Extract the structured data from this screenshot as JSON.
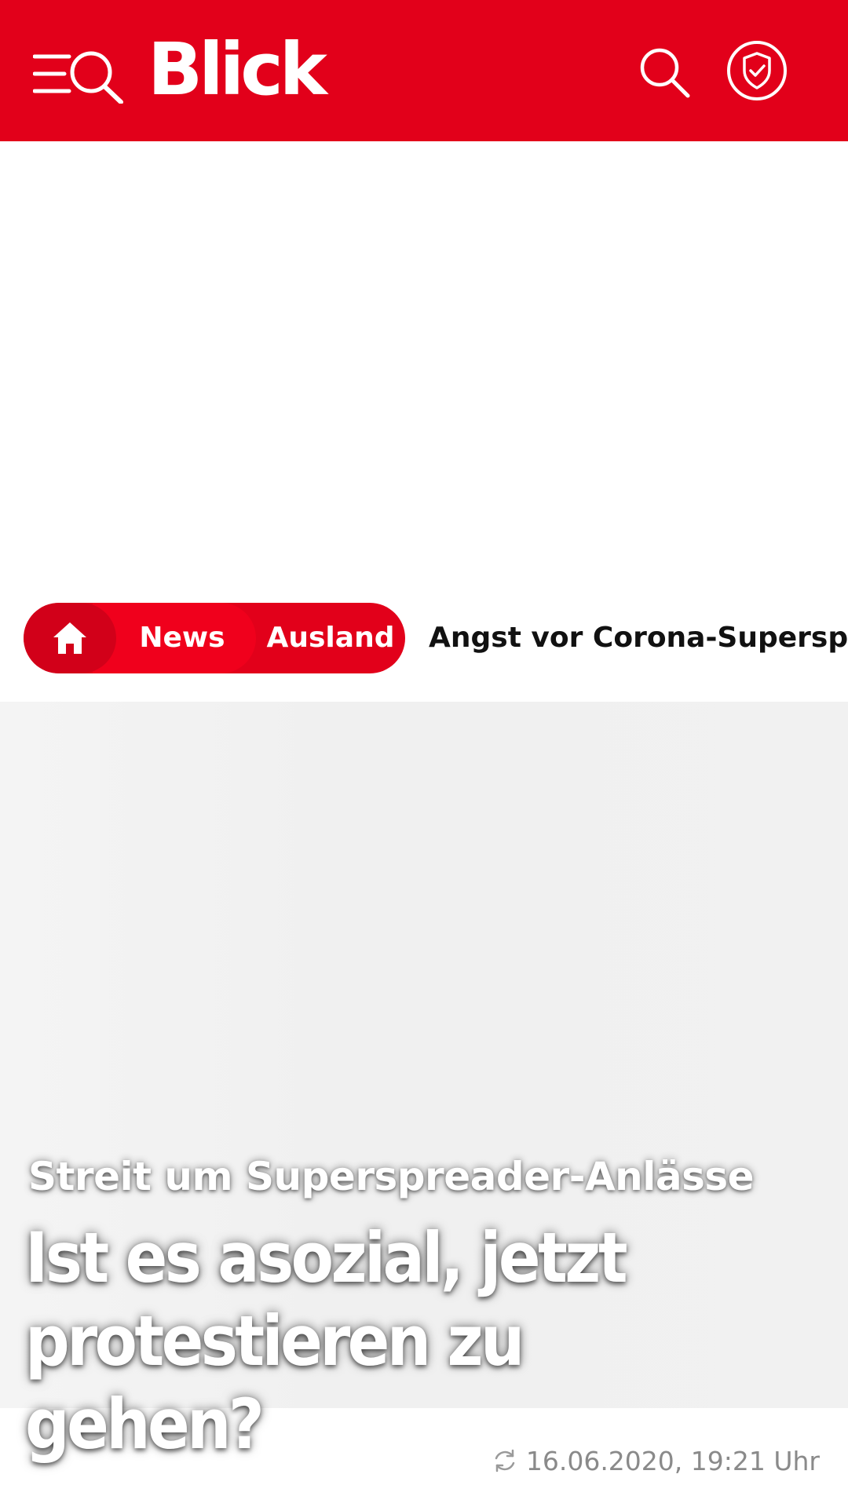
{
  "header": {
    "logo": "Blick",
    "brand_color": "#e2001a",
    "menu_icon": "menu-search-icon",
    "search_icon": "search-icon",
    "account_icon": "shield-check-icon"
  },
  "breadcrumb": {
    "home_icon": "home-icon",
    "items": [
      "News",
      "Ausland"
    ],
    "current": "Angst vor Corona-Superspread"
  },
  "article": {
    "kicker": "Streit um Superspreader-Anlässe",
    "headline": "Ist es asozial, jetzt protestieren zu gehen?",
    "timestamp": "16.06.2020, 19:21 Uhr",
    "timestamp_icon": "refresh-icon"
  }
}
